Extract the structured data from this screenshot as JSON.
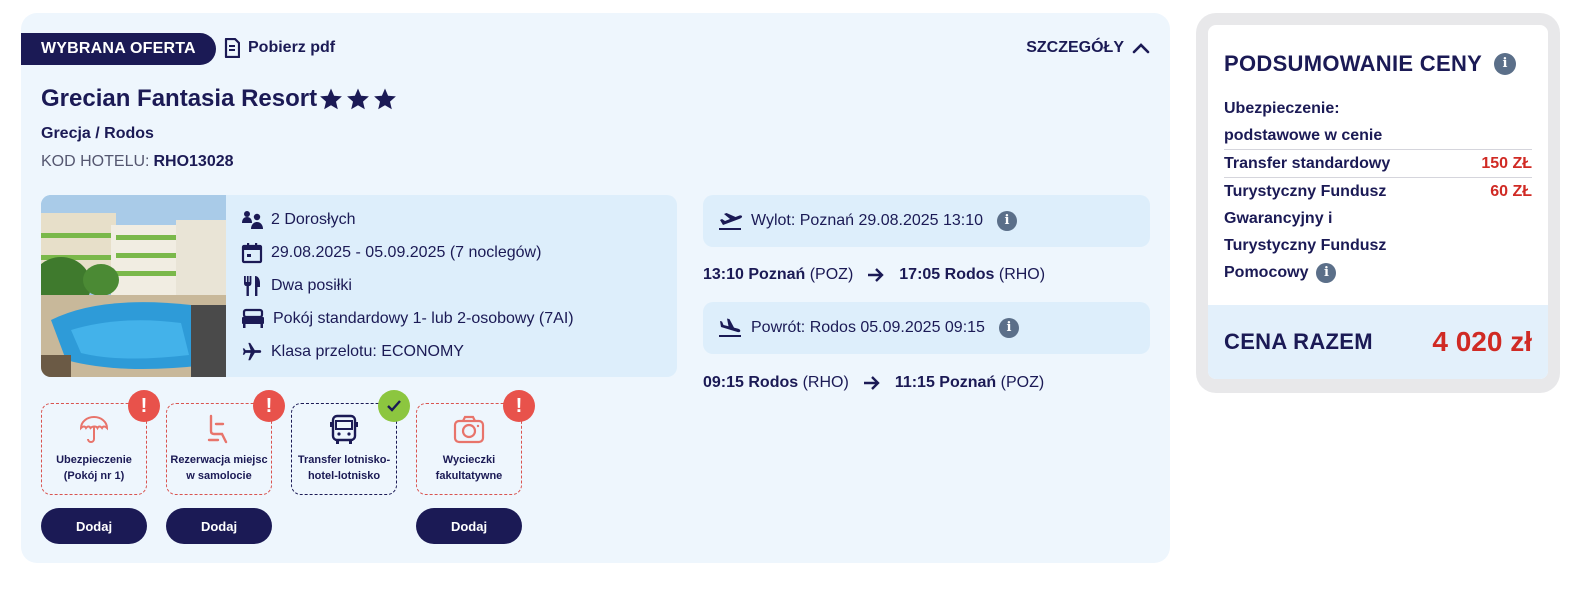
{
  "offer": {
    "badge": "WYBRANA OFERTA",
    "pdf_label": "Pobierz pdf",
    "details_label": "SZCZEGÓŁY",
    "hotel_name": "Grecian Fantasia Resort",
    "stars": 3,
    "region": "Grecja / Rodos",
    "code_label": "KOD HOTELU:",
    "code_value": "RHO13028",
    "info": {
      "guests": "2 Dorosłych",
      "dates": "29.08.2025 - 05.09.2025 (7 noclegów)",
      "meals": "Dwa posiłki",
      "room": "Pokój standardowy 1- lub 2-osobowy (7AI)",
      "flight_class": "Klasa przelotu: ECONOMY"
    }
  },
  "flights": {
    "outbound_header": "Wylot: Poznań 29.08.2025 13:10",
    "outbound_dep_time": "13:10 Poznań",
    "outbound_dep_code": "(POZ)",
    "outbound_arr_time": "17:05 Rodos",
    "outbound_arr_code": "(RHO)",
    "return_header": "Powrót: Rodos 05.09.2025 09:15",
    "return_dep_time": "09:15 Rodos",
    "return_dep_code": "(RHO)",
    "return_arr_time": "11:15 Poznań",
    "return_arr_code": "(POZ)"
  },
  "services": [
    {
      "label_1": "Ubezpieczenie",
      "label_2": "(Pokój nr 1)",
      "status": "alert",
      "button": "Dodaj"
    },
    {
      "label_1": "Rezerwacja miejsc",
      "label_2": "w samolocie",
      "status": "alert",
      "button": "Dodaj"
    },
    {
      "label_1": "Transfer lotnisko-",
      "label_2": "hotel-lotnisko",
      "status": "ok"
    },
    {
      "label_1": "Wycieczki",
      "label_2": "fakultatywne",
      "status": "alert",
      "button": "Dodaj"
    }
  ],
  "summary": {
    "title": "PODSUMOWANIE CENY",
    "insurance_label": "Ubezpieczenie:",
    "insurance_value": "podstawowe w cenie",
    "transfer_label": "Transfer standardowy",
    "transfer_price": "150 ZŁ",
    "fund_line1": "Turystyczny Fundusz",
    "fund_price": "60 ZŁ",
    "fund_line2": "Gwarancyjny i",
    "fund_line3": "Turystyczny Fundusz",
    "fund_line4": "Pomocowy",
    "total_label": "CENA RAZEM",
    "total_value": "4 020 zł"
  },
  "colors": {
    "navy": "#1b1a55",
    "accent_red": "#d02a24",
    "alert_red": "#e8524b",
    "ok_green": "#8cc63f",
    "panel_bg": "#eef6fd"
  }
}
